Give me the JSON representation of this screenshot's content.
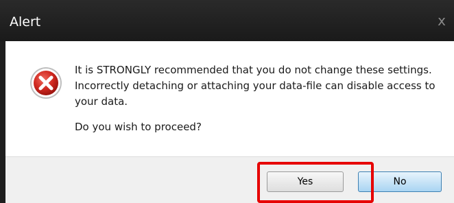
{
  "window": {
    "title": "Alert",
    "close_glyph": "x"
  },
  "dialog": {
    "icon": "error-x-icon",
    "message": "It is STRONGLY recommended that you do not change these settings. Incorrectly detaching or attaching your data-file can disable access to your data.",
    "question": "Do you wish to proceed?"
  },
  "buttons": {
    "yes_label": "Yes",
    "no_label": "No"
  },
  "colors": {
    "highlight": "#e60000",
    "error_red": "#c9201e"
  }
}
